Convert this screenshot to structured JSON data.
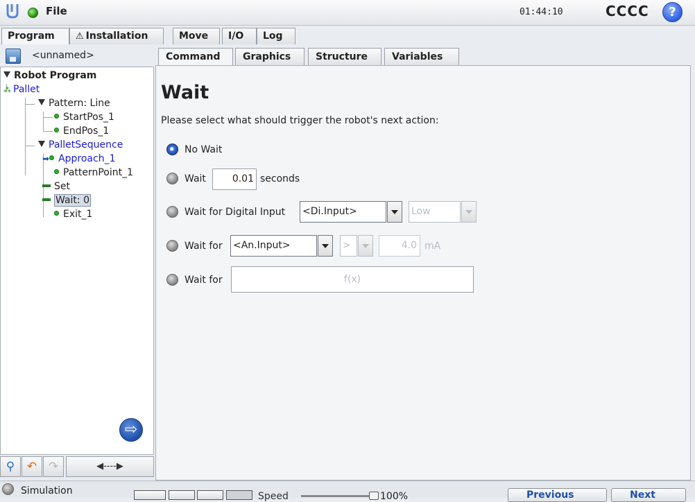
{
  "topbar": {
    "file_label": "File",
    "time": "01:44:10",
    "robot_name": "CCCC",
    "help_label": "?"
  },
  "main_tabs": [
    {
      "label": "Program"
    },
    {
      "label": "Installation"
    },
    {
      "label": "Move"
    },
    {
      "label": "I/O"
    },
    {
      "label": "Log"
    }
  ],
  "program": {
    "name": "<unnamed>"
  },
  "tree": {
    "root": "Robot Program",
    "items": [
      "Pallet",
      "Pattern: Line",
      "StartPos_1",
      "EndPos_1",
      "PalletSequence",
      "Approach_1",
      "PatternPoint_1",
      "Set",
      "Wait: 0",
      "Exit_1"
    ]
  },
  "sub_tabs": [
    {
      "label": "Command"
    },
    {
      "label": "Graphics"
    },
    {
      "label": "Structure"
    },
    {
      "label": "Variables"
    }
  ],
  "command": {
    "title": "Wait",
    "prompt": "Please select what should trigger the robot's next action:",
    "no_wait_label": "No Wait",
    "wait_label": "Wait",
    "wait_value": "0.01",
    "seconds_label": "seconds",
    "digital_label": "Wait for Digital Input",
    "digital_input": "<Di.Input>",
    "digital_state": "Low",
    "analog_label": "Wait for",
    "analog_input": "<An.Input>",
    "analog_op": ">",
    "analog_value": "4.0",
    "analog_unit": "mA",
    "expr_label": "Wait for",
    "expr_placeholder": "f(x)"
  },
  "bottom": {
    "simulation_label": "Simulation",
    "speed_label": "Speed",
    "speed_value": "100%",
    "speed_level_percent": 100,
    "previous_label": "Previous",
    "next_label": "Next"
  },
  "colors": {
    "accent_blue": "#1f4fa8",
    "tree_link": "#1a1ad6",
    "status_green": "#2db32d"
  }
}
